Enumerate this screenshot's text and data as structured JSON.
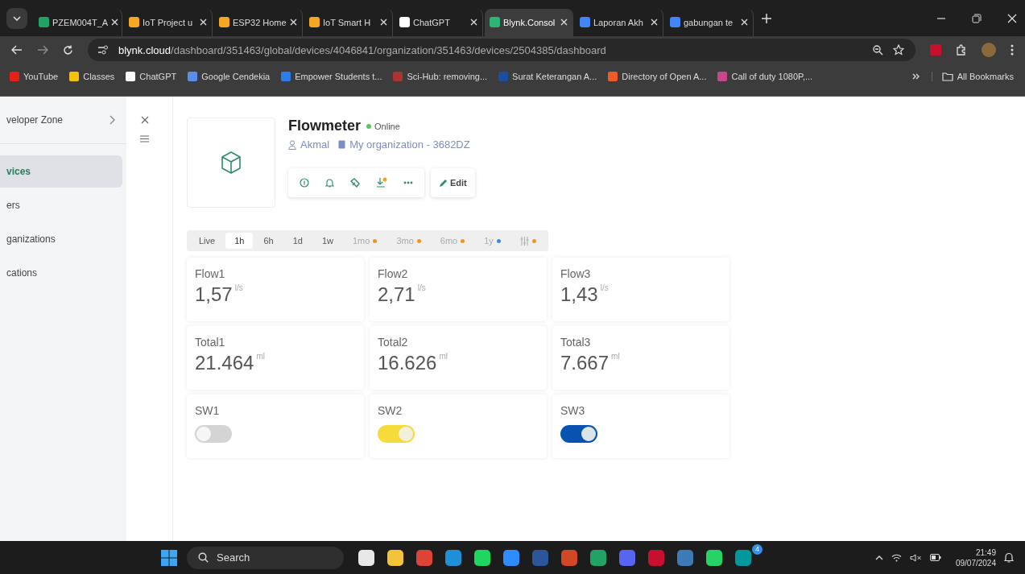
{
  "browser": {
    "tabs": [
      {
        "title": "PZEM004T_A",
        "selected": false
      },
      {
        "title": "IoT Project u",
        "selected": false
      },
      {
        "title": "ESP32 Home",
        "selected": false
      },
      {
        "title": "IoT Smart H",
        "selected": false
      },
      {
        "title": "ChatGPT",
        "selected": false
      },
      {
        "title": "Blynk.Consol",
        "selected": true
      },
      {
        "title": "Laporan Akh",
        "selected": false
      },
      {
        "title": "gabungan te",
        "selected": false
      }
    ],
    "address": {
      "host": "blynk.cloud",
      "path": "/dashboard/351463/global/devices/4046841/organization/351463/devices/2504385/dashboard"
    },
    "bookmarks": [
      "YouTube",
      "Classes",
      "ChatGPT",
      "Google Cendekia",
      "Empower Students t...",
      "Sci-Hub: removing...",
      "Surat Keterangan A...",
      "Directory of Open A...",
      "Call of duty 1080P,..."
    ],
    "all_bookmarks": "All Bookmarks"
  },
  "sidebar": {
    "items": [
      {
        "label": "veloper Zone",
        "kind": "section"
      },
      {
        "label": "vices",
        "selected": true,
        "kind": "link"
      },
      {
        "label": "ers",
        "selected": false,
        "kind": "link"
      },
      {
        "label": "ganizations",
        "selected": false,
        "kind": "link"
      },
      {
        "label": "cations",
        "selected": false,
        "kind": "link"
      }
    ]
  },
  "device": {
    "name": "Flowmeter",
    "status": "Online",
    "online": true,
    "owner": "Akmal",
    "organization": "My organization - 3682DZ",
    "edit_label": "Edit"
  },
  "time_ranges": [
    {
      "label": "Live",
      "selected": false
    },
    {
      "label": "1h",
      "selected": true
    },
    {
      "label": "6h",
      "selected": false
    },
    {
      "label": "1d",
      "selected": false
    },
    {
      "label": "1w",
      "selected": false
    },
    {
      "label": "1mo",
      "selected": false,
      "color": "#f0961e"
    },
    {
      "label": "3mo",
      "selected": false,
      "color": "#f0961e"
    },
    {
      "label": "6mo",
      "selected": false,
      "color": "#f0961e"
    },
    {
      "label": "1y",
      "selected": false,
      "color": "#2d8fe0"
    },
    {
      "kind": "settings",
      "selected": false,
      "color": "#f0961e"
    }
  ],
  "widgets": [
    {
      "kind": "value",
      "label": "Flow1",
      "value": "1,57",
      "unit": "l/s"
    },
    {
      "kind": "value",
      "label": "Flow2",
      "value": "2,71",
      "unit": "l/s"
    },
    {
      "kind": "value",
      "label": "Flow3",
      "value": "1,43",
      "unit": "l/s"
    },
    {
      "kind": "value",
      "label": "Total1",
      "value": "21.464",
      "unit": "ml"
    },
    {
      "kind": "value",
      "label": "Total2",
      "value": "16.626",
      "unit": "ml"
    },
    {
      "kind": "value",
      "label": "Total3",
      "value": "7.667",
      "unit": "ml"
    },
    {
      "kind": "switch",
      "label": "SW1",
      "on": false,
      "color": "#d4d4d4"
    },
    {
      "kind": "switch",
      "label": "SW2",
      "on": true,
      "color": "#f5dc3a"
    },
    {
      "kind": "switch",
      "label": "SW3",
      "on": true,
      "color": "#0a52b0"
    }
  ],
  "taskbar": {
    "search_placeholder": "Search",
    "badge": "4",
    "time": "21:49",
    "date": "09/07/2024"
  }
}
